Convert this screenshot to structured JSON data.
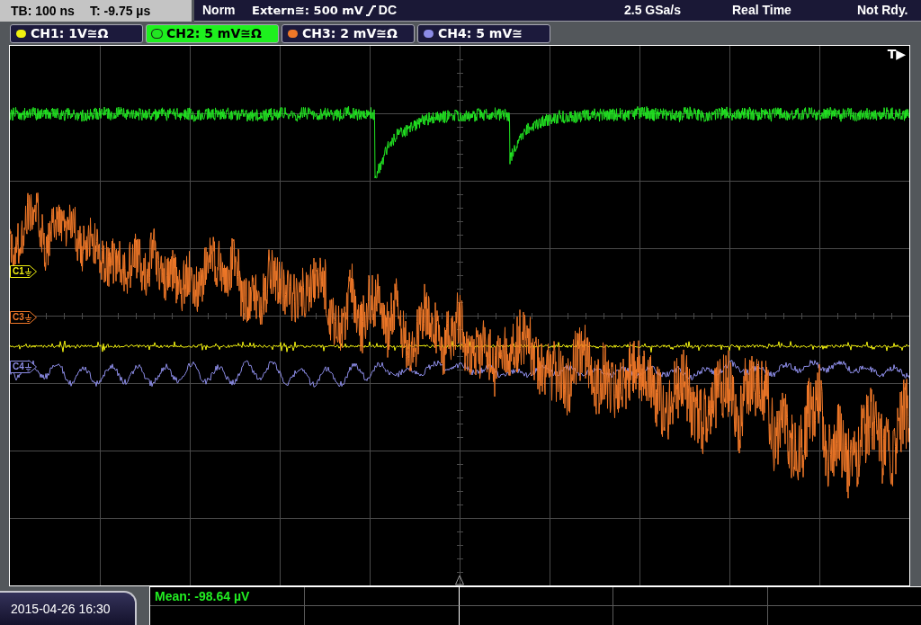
{
  "status_bar": {
    "timebase": "TB: 100 ns",
    "trigger_time": "T: -9.75 µs",
    "trigger_mode": "Norm",
    "trigger_source": "Extern≅: 500 mV",
    "slope_rising": true,
    "trigger_coupling": "DC",
    "sample_rate": "2.5 GSa/s",
    "acquisition": "Real Time",
    "state": "Not Rdy."
  },
  "channels": [
    {
      "label": "CH1: 1V≅Ω",
      "color": "#f0f010",
      "selected": false,
      "marker": "C1"
    },
    {
      "label": "CH2: 5 mV≅Ω",
      "color": "#22e622",
      "selected": true
    },
    {
      "label": "CH3: 2 mV≅Ω",
      "color": "#f07828",
      "selected": false,
      "marker": "C3"
    },
    {
      "label": "CH4: 5 mV≅",
      "color": "#8c8ce6",
      "selected": false,
      "marker": "C4"
    }
  ],
  "trigger_marker": "T▶",
  "measurements": [
    "Mean: -98.64 µV"
  ],
  "date_time": "2015-04-26 16:30"
}
